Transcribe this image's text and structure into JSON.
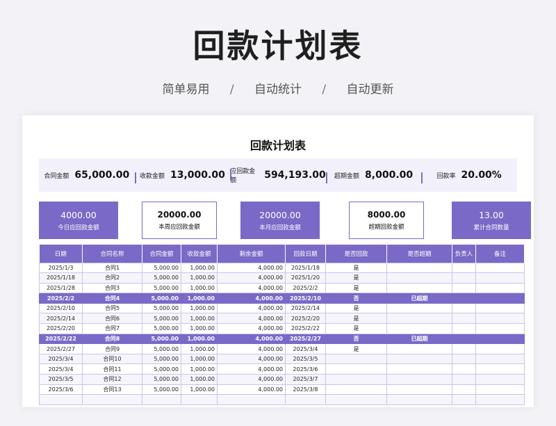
{
  "header": {
    "title": "回款计划表",
    "tags": [
      "简单易用",
      "自动统计",
      "自动更新"
    ],
    "separator": "/"
  },
  "sheet": {
    "title": "回款计划表",
    "summary": [
      {
        "label": "合同金额",
        "value": "65,000.00"
      },
      {
        "label": "收款金额",
        "value": "13,000.00"
      },
      {
        "label": "应回款金额",
        "value": "594,193.00"
      },
      {
        "label": "超期金额",
        "value": "8,000.00"
      },
      {
        "label": "回款率",
        "value": "20.00%"
      }
    ],
    "cards": [
      {
        "value": "4000.00",
        "label": "今日应回款金额",
        "style": "filled"
      },
      {
        "value": "20000.00",
        "label": "本周应回款金额",
        "style": "outline"
      },
      {
        "value": "20000.00",
        "label": "本月应回款金额",
        "style": "filled"
      },
      {
        "value": "8000.00",
        "label": "超期回款金额",
        "style": "outline"
      },
      {
        "value": "13.00",
        "label": "累计合同数量",
        "style": "filled"
      }
    ],
    "table": {
      "columns": [
        "日期",
        "合同名称",
        "合同金额",
        "收款金额",
        "剩余金额",
        "回款日期",
        "是否回款",
        "是否超期",
        "负责人",
        "备注"
      ],
      "rows": [
        [
          "2025/1/3",
          "合同1",
          "5,000.00",
          "1,000.00",
          "4,000.00",
          "2025/1/18",
          "是",
          "",
          "",
          ""
        ],
        [
          "2025/1/18",
          "合同2",
          "5,000.00",
          "1,000.00",
          "4,000.00",
          "2025/1/20",
          "是",
          "",
          "",
          ""
        ],
        [
          "2025/1/28",
          "合同3",
          "5,000.00",
          "1,000.00",
          "4,000.00",
          "2025/2/2",
          "是",
          "",
          "",
          ""
        ],
        [
          "2025/2/2",
          "合同4",
          "5,000.00",
          "1,000.00",
          "4,000.00",
          "2025/2/10",
          "否",
          "已超期",
          "",
          ""
        ],
        [
          "2025/2/10",
          "合同5",
          "5,000.00",
          "1,000.00",
          "4,000.00",
          "2025/2/14",
          "是",
          "",
          "",
          ""
        ],
        [
          "2025/2/14",
          "合同6",
          "5,000.00",
          "1,000.00",
          "4,000.00",
          "2025/2/20",
          "是",
          "",
          "",
          ""
        ],
        [
          "2025/2/20",
          "合同7",
          "5,000.00",
          "1,000.00",
          "4,000.00",
          "2025/2/22",
          "是",
          "",
          "",
          ""
        ],
        [
          "2025/2/22",
          "合同8",
          "5,000.00",
          "1,000.00",
          "4,000.00",
          "2025/2/27",
          "否",
          "已超期",
          "",
          ""
        ],
        [
          "2025/2/27",
          "合同9",
          "5,000.00",
          "1,000.00",
          "4,000.00",
          "2025/3/4",
          "是",
          "",
          "",
          ""
        ],
        [
          "2025/3/4",
          "合同10",
          "5,000.00",
          "1,000.00",
          "4,000.00",
          "2025/3/5",
          "",
          "",
          "",
          ""
        ],
        [
          "2025/3/4",
          "合同11",
          "5,000.00",
          "1,000.00",
          "4,000.00",
          "2025/3/6",
          "",
          "",
          "",
          ""
        ],
        [
          "2025/3/5",
          "合同12",
          "5,000.00",
          "1,000.00",
          "4,000.00",
          "2025/3/7",
          "",
          "",
          "",
          ""
        ],
        [
          "2025/3/6",
          "合同13",
          "5,000.00",
          "1,000.00",
          "4,000.00",
          "2025/3/8",
          "",
          "",
          "",
          ""
        ],
        [
          "",
          "",
          "",
          "",
          "",
          "",
          "",
          "",
          "",
          ""
        ]
      ],
      "highlighted_rows": [
        3,
        7
      ]
    }
  },
  "colors": {
    "accent": "#7a69c7",
    "summary_bg": "#f2f1fb",
    "page_bg": "#f3f3f7"
  }
}
